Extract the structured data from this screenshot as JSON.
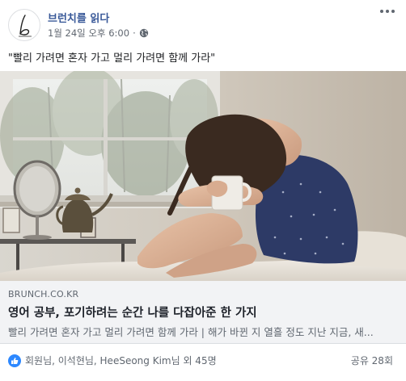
{
  "post": {
    "page_name": "브런치를 읽다",
    "timestamp": "1월 24일 오후 6:00",
    "separator": "·",
    "privacy_icon": "globe-icon",
    "more_icon": "more-options-icon",
    "text": "\"빨리 가려면 혼자 가고 멀리 가려면 함께 가라\""
  },
  "photo": {
    "description_icon": "photo"
  },
  "link_preview": {
    "domain": "BRUNCH.CO.KR",
    "title": "영어 공부, 포기하려는 순간 나를 다잡아준 한 가지",
    "description": "빨리 가려면 혼자 가고 멀리 가려면 함께 가라 | 해가 바뀐 지 열흘 정도 지난 지금, 새..."
  },
  "footer": {
    "reactions_text": "회원님, 이석현님, HeeSeong Kim님 외 45명",
    "shares_text": "공유 28회"
  },
  "colors": {
    "link_blue": "#385898",
    "like_blue": "#2d88ff",
    "meta_gray": "#606770",
    "preview_bg": "#f2f3f5"
  }
}
